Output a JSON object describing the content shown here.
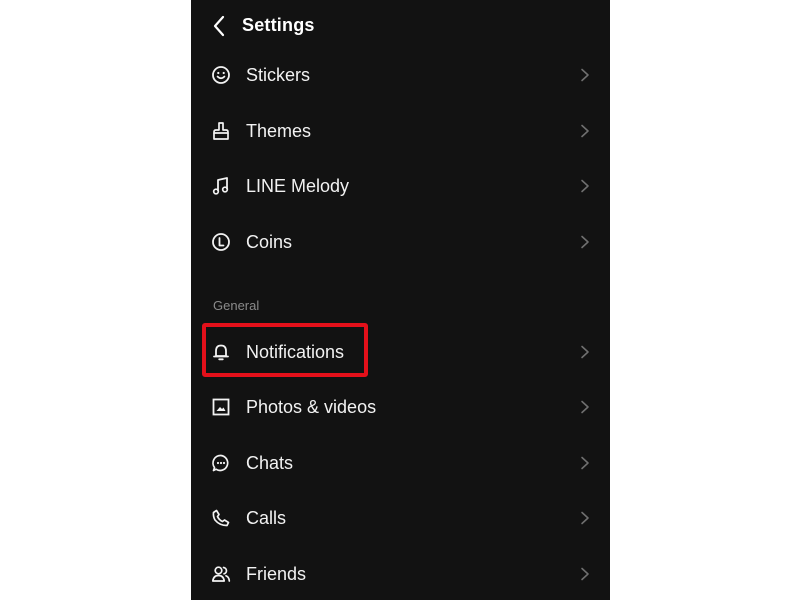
{
  "header": {
    "title": "Settings",
    "back_icon": "chevron-left-icon"
  },
  "rows_top": [
    {
      "id": "stickers",
      "label": "Stickers",
      "icon": "smiley-icon"
    },
    {
      "id": "themes",
      "label": "Themes",
      "icon": "brush-icon"
    },
    {
      "id": "line-melody",
      "label": "LINE Melody",
      "icon": "music-note-icon"
    },
    {
      "id": "coins",
      "label": "Coins",
      "icon": "coin-icon"
    }
  ],
  "section": {
    "label": "General"
  },
  "rows_general": [
    {
      "id": "notifications",
      "label": "Notifications",
      "icon": "bell-icon",
      "highlighted": true
    },
    {
      "id": "photos-videos",
      "label": "Photos & videos",
      "icon": "image-icon"
    },
    {
      "id": "chats",
      "label": "Chats",
      "icon": "chat-bubble-icon"
    },
    {
      "id": "calls",
      "label": "Calls",
      "icon": "phone-icon"
    },
    {
      "id": "friends",
      "label": "Friends",
      "icon": "friends-icon"
    }
  ],
  "colors": {
    "background": "#121212",
    "text": "#f2f2f2",
    "section_text": "#8a8a8a",
    "chevron": "#6f6f6f",
    "highlight": "#e3101a"
  }
}
